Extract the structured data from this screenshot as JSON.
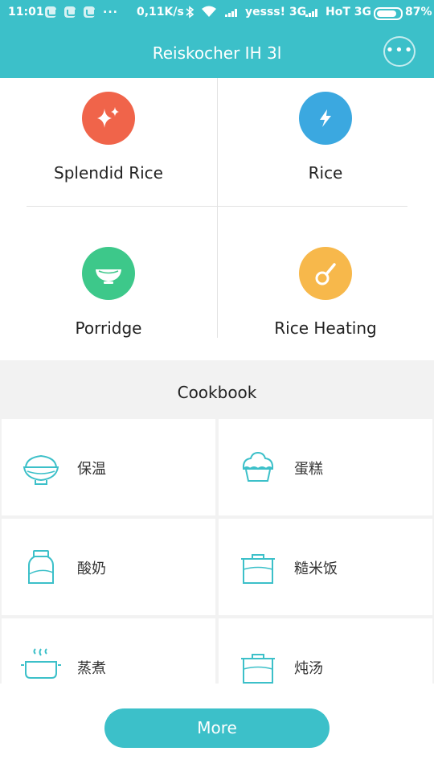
{
  "status_bar": {
    "time": "11:01",
    "dots": "...",
    "speed": "0,11K/s",
    "carrier1": "yesss! 3G",
    "carrier2": "HoT 3G",
    "battery": "87%",
    "battery_level": 0.87
  },
  "header": {
    "title": "Reiskocher IH 3l",
    "menu_icon": "more-dots-icon"
  },
  "modes": [
    {
      "label": "Splendid Rice",
      "icon": "sparkle-icon",
      "color": "#f0644a"
    },
    {
      "label": "Rice",
      "icon": "lightning-icon",
      "color": "#3ba8e0"
    },
    {
      "label": "Porridge",
      "icon": "bowl-icon",
      "color": "#3dc88a"
    },
    {
      "label": "Rice Heating",
      "icon": "spoon-icon",
      "color": "#f7b84b"
    }
  ],
  "cookbook": {
    "title": "Cookbook",
    "items": [
      {
        "label": "保温",
        "icon": "rice-bowl-icon"
      },
      {
        "label": "蛋糕",
        "icon": "cupcake-icon"
      },
      {
        "label": "酸奶",
        "icon": "yogurt-jar-icon"
      },
      {
        "label": "糙米饭",
        "icon": "pot-icon"
      },
      {
        "label": "蒸煮",
        "icon": "steaming-pot-icon"
      },
      {
        "label": "炖汤",
        "icon": "soup-pot-icon"
      }
    ]
  },
  "more_button": {
    "label": "More"
  },
  "colors": {
    "accent": "#3cc0c9",
    "icon_stroke": "#3cc0c9"
  }
}
